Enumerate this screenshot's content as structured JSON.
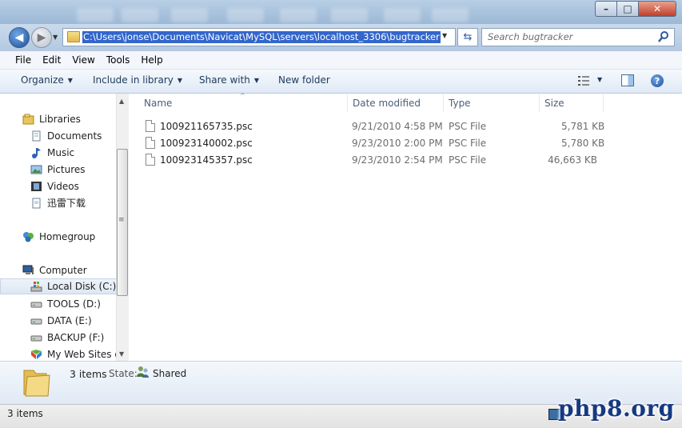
{
  "window": {
    "min": "–",
    "max": "□",
    "close": "✕"
  },
  "address": {
    "path": "C:\\Users\\jonse\\Documents\\Navicat\\MySQL\\servers\\localhost_3306\\bugtracker"
  },
  "search": {
    "placeholder": "Search bugtracker"
  },
  "menu": [
    "File",
    "Edit",
    "View",
    "Tools",
    "Help"
  ],
  "toolbar": {
    "organize": "Organize",
    "include": "Include in library",
    "share": "Share with",
    "newfolder": "New folder"
  },
  "nav": {
    "libraries": "Libraries",
    "documents": "Documents",
    "music": "Music",
    "pictures": "Pictures",
    "videos": "Videos",
    "downloads": "迅雷下载",
    "homegroup": "Homegroup",
    "computer": "Computer",
    "localdisk": "Local Disk (C:)",
    "tools": "TOOLS (D:)",
    "data": "DATA (E:)",
    "backup": "BACKUP (F:)",
    "websites": "My Web Sites on"
  },
  "columns": {
    "name": "Name",
    "date": "Date modified",
    "type": "Type",
    "size": "Size"
  },
  "files": [
    {
      "name": "100921165735.psc",
      "date": "9/21/2010 4:58 PM",
      "type": "PSC File",
      "size": "5,781 KB"
    },
    {
      "name": "100923140002.psc",
      "date": "9/23/2010 2:00 PM",
      "type": "PSC File",
      "size": "5,780 KB"
    },
    {
      "name": "100923145357.psc",
      "date": "9/23/2010 2:54 PM",
      "type": "PSC File",
      "size": "46,663 KB"
    }
  ],
  "details": {
    "count": "3 items",
    "state_label": "State:",
    "state_value": "Shared"
  },
  "status": {
    "text": "3 items"
  },
  "watermark": "php8.org"
}
